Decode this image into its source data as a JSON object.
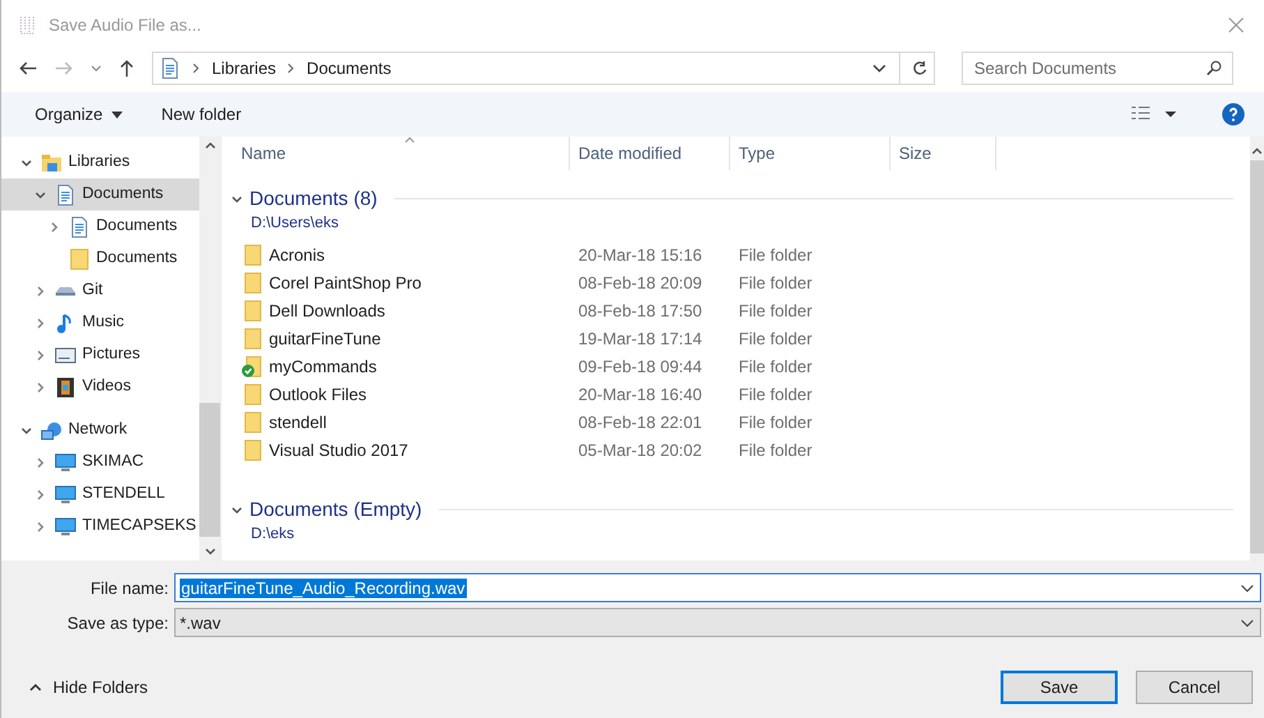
{
  "window": {
    "title": "Save Audio File as..."
  },
  "address": {
    "breadcrumbs": [
      "Libraries",
      "Documents"
    ]
  },
  "search": {
    "placeholder": "Search Documents"
  },
  "toolbar": {
    "organize": "Organize",
    "new_folder": "New folder"
  },
  "sidebar": {
    "items": [
      {
        "label": "Libraries",
        "kind": "library",
        "expanded": true,
        "selected": false,
        "children": [
          {
            "label": "Documents",
            "kind": "document",
            "expanded": true,
            "selected": true,
            "children": [
              {
                "label": "Documents",
                "kind": "document",
                "expanded": false,
                "selected": false
              },
              {
                "label": "Documents",
                "kind": "folder",
                "selected": false
              }
            ]
          },
          {
            "label": "Git",
            "kind": "drive",
            "expanded": false,
            "selected": false
          },
          {
            "label": "Music",
            "kind": "music",
            "expanded": false,
            "selected": false
          },
          {
            "label": "Pictures",
            "kind": "pictures",
            "expanded": false,
            "selected": false
          },
          {
            "label": "Videos",
            "kind": "videos",
            "expanded": false,
            "selected": false
          }
        ]
      },
      {
        "label": "Network",
        "kind": "network",
        "expanded": true,
        "selected": false,
        "children": [
          {
            "label": "SKIMAC",
            "kind": "computer",
            "expanded": false,
            "selected": false
          },
          {
            "label": "STENDELL",
            "kind": "computer",
            "expanded": false,
            "selected": false
          },
          {
            "label": "TIMECAPSEKS",
            "kind": "computer",
            "expanded": false,
            "selected": false
          }
        ]
      }
    ]
  },
  "table": {
    "columns": [
      "Name",
      "Date modified",
      "Type",
      "Size"
    ],
    "groups": [
      {
        "title": "Documents (8)",
        "path": "D:\\Users\\eks",
        "expanded": true,
        "rows": [
          {
            "name": "Acronis",
            "date": "20-Mar-18 15:16",
            "type": "File folder",
            "kind": "folder"
          },
          {
            "name": "Corel PaintShop Pro",
            "date": "08-Feb-18 20:09",
            "type": "File folder",
            "kind": "folder"
          },
          {
            "name": "Dell Downloads",
            "date": "08-Feb-18 17:50",
            "type": "File folder",
            "kind": "folder"
          },
          {
            "name": "guitarFineTune",
            "date": "19-Mar-18 17:14",
            "type": "File folder",
            "kind": "folder"
          },
          {
            "name": "myCommands",
            "date": "09-Feb-18 09:44",
            "type": "File folder",
            "kind": "synced"
          },
          {
            "name": "Outlook Files",
            "date": "20-Mar-18 16:40",
            "type": "File folder",
            "kind": "folder"
          },
          {
            "name": "stendell",
            "date": "08-Feb-18 22:01",
            "type": "File folder",
            "kind": "folder"
          },
          {
            "name": "Visual Studio 2017",
            "date": "05-Mar-18 20:02",
            "type": "File folder",
            "kind": "folder"
          }
        ]
      },
      {
        "title": "Documents (Empty)",
        "path": "D:\\eks",
        "expanded": true
      }
    ]
  },
  "form": {
    "file_name_label": "File name:",
    "file_name": "guitarFineTune_Audio_Recording.wav",
    "type_label": "Save as type:",
    "type": "*.wav"
  },
  "footer": {
    "hide_folders": "Hide Folders",
    "buttons": [
      "Save",
      "Cancel"
    ]
  }
}
